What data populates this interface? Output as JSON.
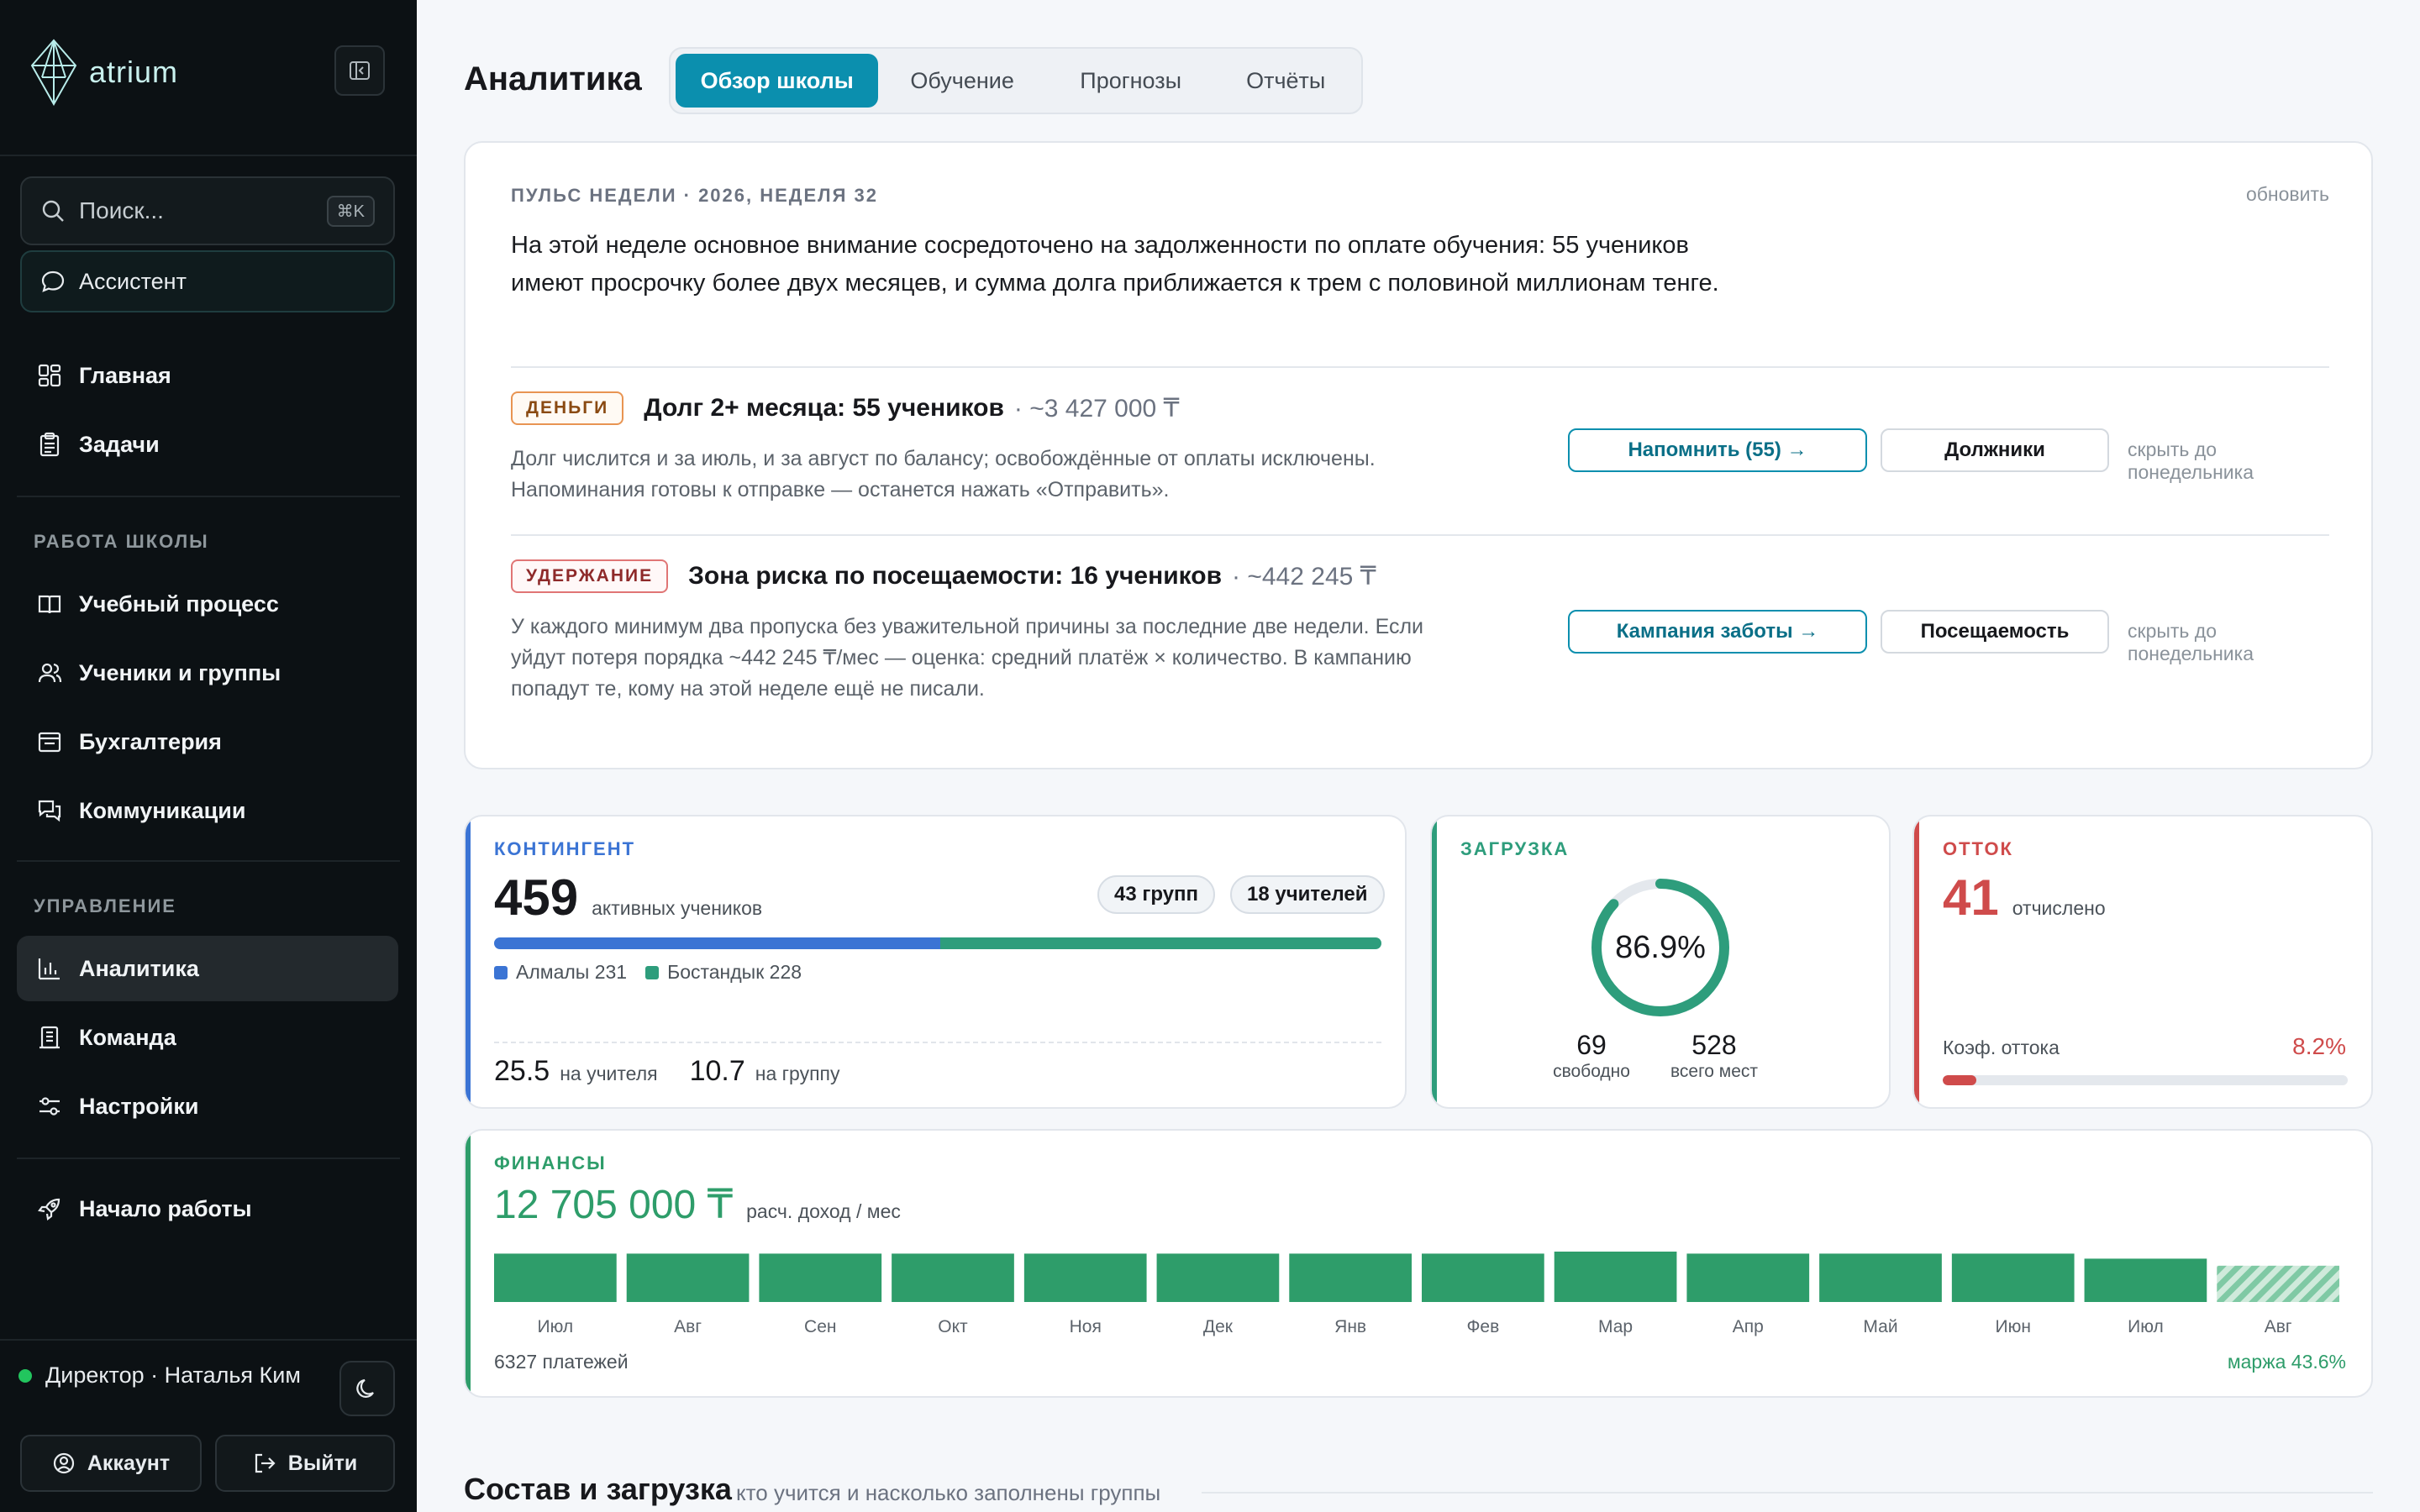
{
  "app": {
    "name": "atrium"
  },
  "sidebar": {
    "search_placeholder": "Поиск...",
    "search_shortcut": "⌘K",
    "assistant_label": "Ассистент",
    "top_items": [
      {
        "label": "Главная",
        "icon": "dashboard-icon"
      },
      {
        "label": "Задачи",
        "icon": "clipboard-icon"
      }
    ],
    "section_school": "РАБОТА ШКОЛЫ",
    "school_items": [
      {
        "label": "Учебный процесс",
        "icon": "book-icon"
      },
      {
        "label": "Ученики и группы",
        "icon": "users-icon"
      },
      {
        "label": "Бухгалтерия",
        "icon": "ledger-icon"
      },
      {
        "label": "Коммуникации",
        "icon": "chat-icon"
      }
    ],
    "section_manage": "УПРАВЛЕНИЕ",
    "manage_items": [
      {
        "label": "Аналитика",
        "icon": "bar-chart-icon",
        "active": true
      },
      {
        "label": "Команда",
        "icon": "building-icon"
      },
      {
        "label": "Настройки",
        "icon": "sliders-icon"
      }
    ],
    "start_label": "Начало работы",
    "user_label": "Директор · Наталья Ким",
    "account_label": "Аккаунт",
    "logout_label": "Выйти"
  },
  "header": {
    "title": "Аналитика",
    "tabs": [
      {
        "label": "Обзор школы",
        "active": true
      },
      {
        "label": "Обучение"
      },
      {
        "label": "Прогнозы"
      },
      {
        "label": "Отчёты"
      }
    ]
  },
  "pulse": {
    "eyebrow": "ПУЛЬС НЕДЕЛИ · 2026, НЕДЕЛЯ 32",
    "refresh_label": "обновить",
    "summary": "На этой неделе основное внимание сосредоточено на задолженности по оплате обучения: 55 учеников имеют просрочку более двух месяцев, и сумма долга приближается к трем с половиной миллионам тенге.",
    "alerts": [
      {
        "tag": "ДЕНЬГИ",
        "title": "Долг 2+ месяца: 55 учеников",
        "sum": "· ~3 427 000 ₸",
        "desc": "Долг числится и за июль, и за август по балансу; освобождённые от оплаты исключены. Напоминания готовы к отправке — останется нажать «Отправить».",
        "primary": "Напомнить (55) →",
        "secondary": "Должники",
        "hide": "скрыть до понедельника"
      },
      {
        "tag": "УДЕРЖАНИЕ",
        "title": "Зона риска по посещаемости: 16 учеников",
        "sum": "· ~442 245 ₸",
        "desc": "У каждого минимум два пропуска без уважительной причины за последние две недели. Если уйдут потеря порядка ~442 245 ₸/мес — оценка: средний платёж × количество. В кампанию попадут те, кому на этой неделе ещё не писали.",
        "primary": "Кампания заботы →",
        "secondary": "Посещаемость",
        "hide": "скрыть до понедельника"
      }
    ]
  },
  "contingent": {
    "eyebrow": "КОНТИНГЕНТ",
    "count": "459",
    "count_label": "активных учеников",
    "groups_pill": "43 групп",
    "teachers_pill": "18 учителей",
    "split": [
      {
        "label": "Алмалы 231",
        "value": 231,
        "color": "#3b74d4"
      },
      {
        "label": "Бостандык 228",
        "value": 228,
        "color": "#2e9d7c"
      }
    ],
    "per_teacher": "25.5",
    "per_teacher_label": "на учителя",
    "per_group": "10.7",
    "per_group_label": "на группу",
    "accent": "#3b74d4"
  },
  "load": {
    "eyebrow": "ЗАГРУЗКА",
    "percent_label": "86.9%",
    "percent": 86.9,
    "free": "69",
    "free_label": "свободно",
    "total": "528",
    "total_label": "всего мест",
    "accent": "#2e9d7c"
  },
  "churn": {
    "eyebrow": "ОТТОК",
    "count": "41",
    "count_label": "отчислено",
    "rate_label": "Коэф. оттока",
    "rate": "8.2%",
    "rate_value": 8.2,
    "accent": "#cf4b4b"
  },
  "finance": {
    "eyebrow": "ФИНАНСЫ",
    "amount": "12 705 000 ₸",
    "amount_label": "расч. доход / мес",
    "payments": "6327 платежей",
    "margin": "маржа 43.6%",
    "accent": "#2e9d6a"
  },
  "chart_data": {
    "type": "bar",
    "categories": [
      "Июл",
      "Авг",
      "Сен",
      "Окт",
      "Ноя",
      "Дек",
      "Янв",
      "Фев",
      "Мар",
      "Апр",
      "Май",
      "Июн",
      "Июл",
      "Авг"
    ],
    "values": [
      96,
      96,
      96,
      96,
      96,
      96,
      96,
      96,
      100,
      96,
      96,
      96,
      86,
      72
    ],
    "projected_last": true,
    "title": "",
    "xlabel": "",
    "ylabel": ""
  },
  "composition": {
    "title": "Состав и загрузка",
    "subtitle": "кто учится и насколько заполнены группы"
  }
}
